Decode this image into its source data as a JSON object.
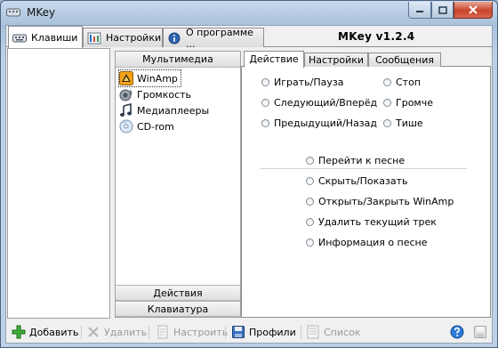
{
  "window": {
    "title": "MKey"
  },
  "main_tabs": [
    {
      "label": "Клавиши"
    },
    {
      "label": "Настройки"
    },
    {
      "label": "О программе ..."
    }
  ],
  "version": "MKey v1.2.4",
  "categories": {
    "header": "Мультимедиа",
    "items": [
      {
        "label": "WinAmp",
        "icon": "winamp-icon"
      },
      {
        "label": "Громкость",
        "icon": "speaker-icon"
      },
      {
        "label": "Медиаплееры",
        "icon": "music-note-icon"
      },
      {
        "label": "CD-rom",
        "icon": "cd-icon"
      }
    ],
    "footer_headers": [
      "Действия",
      "Клавиатура"
    ]
  },
  "sub_tabs": [
    {
      "label": "Действие"
    },
    {
      "label": "Настройки"
    },
    {
      "label": "Сообщения"
    }
  ],
  "actions_left": [
    "Играть/Пауза",
    "Следующий/Вперёд",
    "Предыдущий/Назад"
  ],
  "actions_right": [
    "Стоп",
    "Громче",
    "Тише"
  ],
  "actions_bottom": [
    "Перейти к песне",
    "Скрыть/Показать",
    "Открыть/Закрыть WinAmp",
    "Удалить текущий трек",
    "Информация о песне"
  ],
  "toolbar": {
    "add": "Добавить",
    "delete": "Удалить",
    "configure": "Настроить",
    "profiles": "Профили",
    "list": "Список"
  },
  "colors": {
    "accent": "#3b6fb6",
    "disabled_text": "#9a9a9a",
    "close_button": "#c8422a"
  }
}
